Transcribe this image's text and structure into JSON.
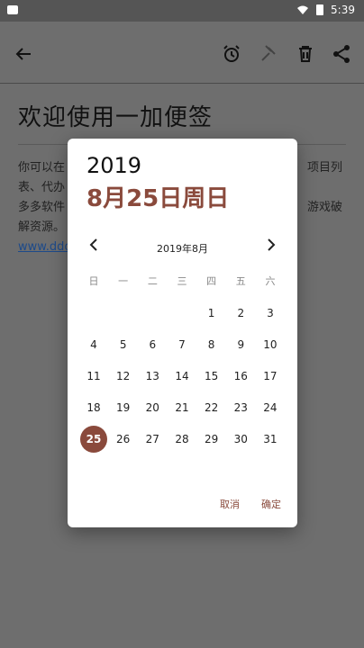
{
  "status": {
    "time": "5:39"
  },
  "note": {
    "title": "欢迎使用一加便签",
    "line1": "你可以在",
    "line1_right": "项目列",
    "line2": "表、代办",
    "line3": "多多软件",
    "line3_right": "游戏破",
    "line4": "解资源。",
    "link_text": "www.ddo"
  },
  "dialog": {
    "year": "2019",
    "date": "8月25日周日",
    "month_title": "2019年8月",
    "weekdays": [
      "日",
      "一",
      "二",
      "三",
      "四",
      "五",
      "六"
    ],
    "weeks": [
      [
        "",
        "",
        "",
        "",
        "1",
        "2",
        "3"
      ],
      [
        "4",
        "5",
        "6",
        "7",
        "8",
        "9",
        "10"
      ],
      [
        "11",
        "12",
        "13",
        "14",
        "15",
        "16",
        "17"
      ],
      [
        "18",
        "19",
        "20",
        "21",
        "22",
        "23",
        "24"
      ],
      [
        "25",
        "26",
        "27",
        "28",
        "29",
        "30",
        "31"
      ]
    ],
    "selected": "25",
    "cancel": "取消",
    "ok": "确定"
  },
  "colors": {
    "accent": "#8a4a3c"
  },
  "icons": [
    "back-arrow-icon",
    "alarm-icon",
    "tools-icon",
    "trash-icon",
    "share-icon",
    "chevron-left-icon",
    "chevron-right-icon"
  ]
}
